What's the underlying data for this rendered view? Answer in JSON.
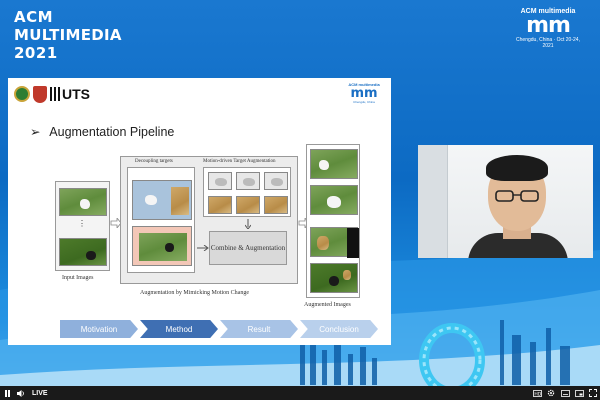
{
  "conference": {
    "title_line1": "ACM",
    "title_line2": "MULTIMEDIA",
    "title_line3": "2021",
    "logo_top": "ACM multimedia",
    "logo_mark": "mm",
    "logo_bottom": "Chengdu, China · Oct 20-24, 2021"
  },
  "slide": {
    "logo_text": "UTS",
    "mm_top": "ACM multimedia",
    "mm_mark": "mm",
    "mm_bottom": "Chengdu, China",
    "heading": "Augmentation Pipeline",
    "bullet": "➢",
    "labels": {
      "input_images": "Input Images",
      "decoupling": "Decoupling targets",
      "motion_driven": "Motion-driven Target Augmentation",
      "combine": "Combine & Augmentation",
      "mimicking": "Augmentation by Mimicking Motion Change",
      "augmented": "Augmented Images",
      "ellipsis": "⋮"
    },
    "pipeline": [
      "Motivation",
      "Method",
      "Result",
      "Conclusion"
    ],
    "colors": {
      "step_inactive": "#8fb0dc",
      "step_active": "#3f6fb3"
    }
  },
  "player": {
    "play_icon": "pause-icon",
    "volume_icon": "volume-icon",
    "live_label": "LIVE",
    "right_icons": [
      "hd-icon",
      "settings-icon",
      "subtitles-icon",
      "pip-icon",
      "fullscreen-icon"
    ]
  }
}
